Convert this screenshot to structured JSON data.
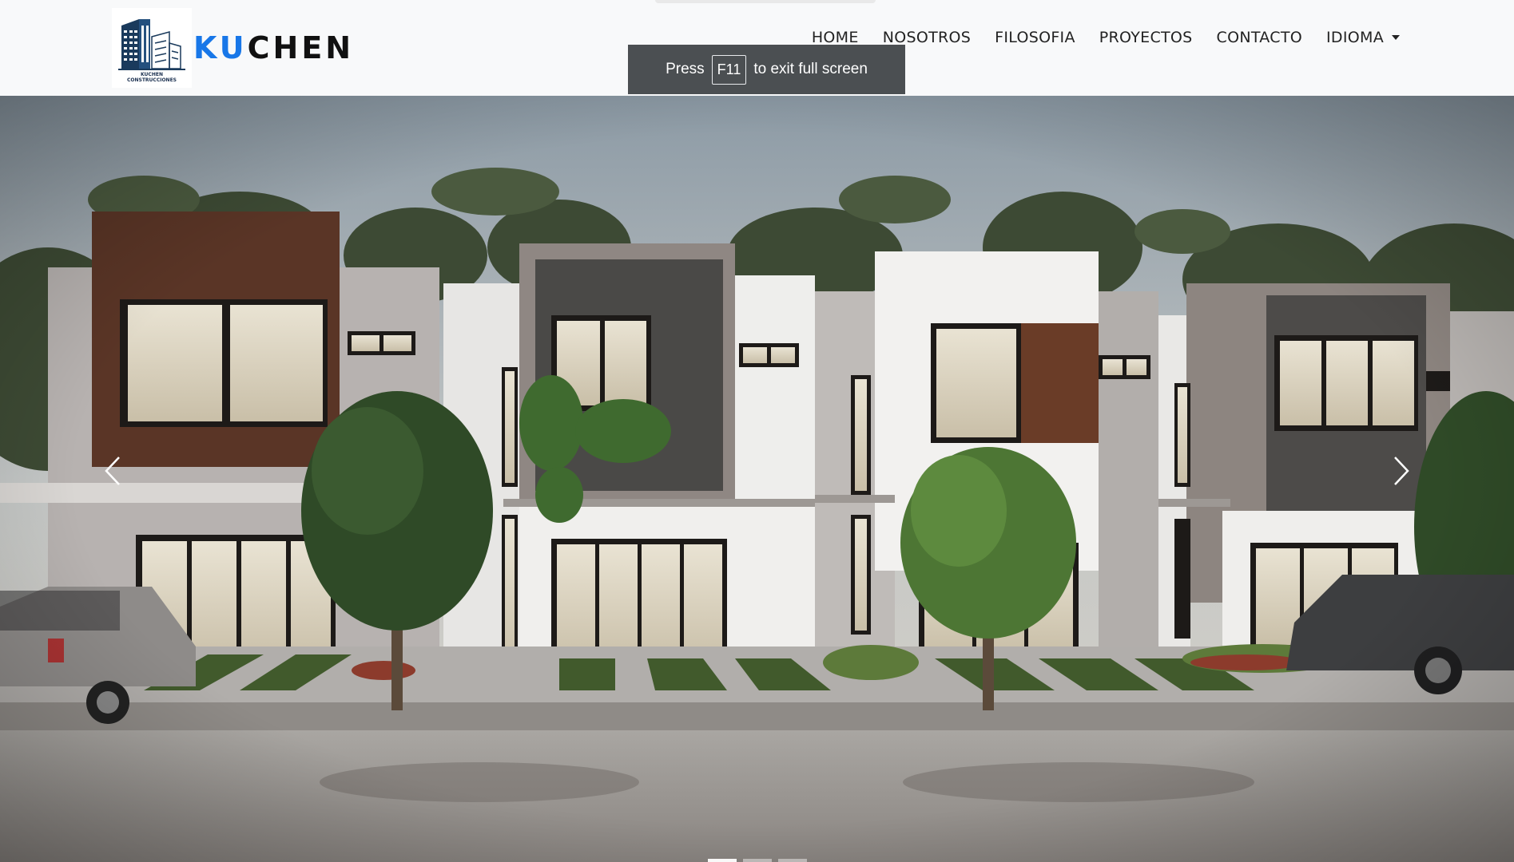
{
  "brand": {
    "name_accent": "KU",
    "name_rest": "CHEN",
    "logo_line1": "KUCHEN",
    "logo_line2": "CONSTRUCCIONES",
    "accent_color": "#1877e8",
    "logo_color": "#1a3a5c"
  },
  "nav": {
    "items": [
      {
        "label": "HOME"
      },
      {
        "label": "NOSOTROS"
      },
      {
        "label": "FILOSOFIA"
      },
      {
        "label": "PROYECTOS"
      },
      {
        "label": "CONTACTO"
      },
      {
        "label": "IDIOMA"
      }
    ]
  },
  "fullscreen_notice": {
    "prefix": "Press",
    "key": "F11",
    "suffix": "to exit full screen"
  },
  "carousel": {
    "slide_count": 3,
    "active_index": 0,
    "prev_icon": "chevron-left-icon",
    "next_icon": "chevron-right-icon"
  }
}
